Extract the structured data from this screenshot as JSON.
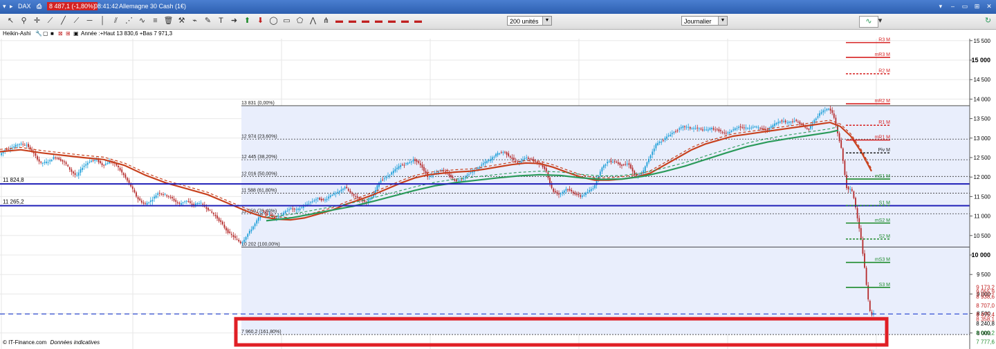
{
  "titlebar": {
    "symbol": "DAX",
    "price_badge": "8 487,1 (-1,80%)",
    "time": "08:41:42",
    "instrument": "Allemagne 30 Cash (1€)"
  },
  "toolbar": {
    "units_select": "200 unités",
    "period_select": "Journalier"
  },
  "legend": {
    "series_label": "Heikin-Ashi",
    "year_info": "Année :+Haut 13 830,6 +Bas 7 971,3"
  },
  "footer": {
    "source": "© IT-Finance.com",
    "note": "Données indicatives"
  },
  "colors": {
    "bull_candle": "#1c9ed8",
    "bear_candle": "#b52a2a",
    "ma_long": "#c8411e",
    "ma_green": "#2a9a5a",
    "support_lines": "#1f1fb8",
    "highlight_box": "#e01f25",
    "fib_band": "#e9eefc"
  },
  "chart_data": {
    "type": "candlestick",
    "y_axis": {
      "ylim": [
        7700,
        15800
      ],
      "ticks": [
        "15 500",
        "15 000",
        "14 500",
        "14 000",
        "13 500",
        "13 000",
        "12 500",
        "12 000",
        "11 500",
        "11 000",
        "10 500",
        "10 000",
        "9 500",
        "9 000",
        "8 500",
        "8 000"
      ],
      "major_ticks": [
        "15 000",
        "10 000"
      ]
    },
    "fibonacci": [
      {
        "label": "13 831 (0,00%)",
        "value": 13831
      },
      {
        "label": "12 974 (23,60%)",
        "value": 12974
      },
      {
        "label": "12 445 (38,20%)",
        "value": 12445
      },
      {
        "label": "12 016 (50,00%)",
        "value": 12016
      },
      {
        "label": "11 588 (61,80%)",
        "value": 11588
      },
      {
        "label": "11 059 (76,40%)",
        "value": 11059
      },
      {
        "label": "10 202 (100,00%)",
        "value": 10202
      },
      {
        "label": "7 960,2 (161,80%)",
        "value": 7960.2
      }
    ],
    "horizontal_lines": [
      {
        "label": "11 824,8",
        "value": 11824.8
      },
      {
        "label": "11 265,2",
        "value": 11265.2
      }
    ],
    "pivots": [
      {
        "label": "R3 M",
        "value": 15450,
        "style": "solid",
        "color": "#d62020"
      },
      {
        "label": "mR3 M",
        "value": 15070,
        "style": "solid",
        "color": "#d62020"
      },
      {
        "label": "R2 M",
        "value": 14650,
        "style": "dotted",
        "color": "#d62020"
      },
      {
        "label": "mR2 M",
        "value": 13880,
        "style": "solid",
        "color": "#d62020"
      },
      {
        "label": "R1 M",
        "value": 13330,
        "style": "dotted",
        "color": "#d62020"
      },
      {
        "label": "mR1 M",
        "value": 12950,
        "style": "solid",
        "color": "#d62020"
      },
      {
        "label": "Piv M",
        "value": 12620,
        "style": "dotted",
        "color": "#222222"
      },
      {
        "label": "mS1 M",
        "value": 11950,
        "style": "solid",
        "color": "#1c8a2a"
      },
      {
        "label": "S1 M",
        "value": 11270,
        "style": "dotted",
        "color": "#1c8a2a"
      },
      {
        "label": "mS2 M",
        "value": 10820,
        "style": "solid",
        "color": "#1c8a2a"
      },
      {
        "label": "S2 M",
        "value": 10410,
        "style": "dotted",
        "color": "#1c8a2a"
      },
      {
        "label": "mS3 M",
        "value": 9810,
        "style": "solid",
        "color": "#1c8a2a"
      },
      {
        "label": "S3 M",
        "value": 9170,
        "style": "solid",
        "color": "#1c8a2a"
      }
    ],
    "price_tags": [
      {
        "label": "9 173,2",
        "value": 9173.2,
        "color": "#c02020"
      },
      {
        "label": "9 055,9",
        "value": 9055.9,
        "color": "#c02020"
      },
      {
        "label": "8 938,6",
        "value": 8938.6,
        "color": "#c02020"
      },
      {
        "label": "8 707,0",
        "value": 8707.0,
        "color": "#c02020"
      },
      {
        "label": "8 475,4",
        "value": 8475.4,
        "color": "#c02020"
      },
      {
        "label": "8 358,1",
        "value": 8358.1,
        "color": "#c02020"
      },
      {
        "label": "8 240,8",
        "value": 8240.8,
        "color": "#000000"
      },
      {
        "label": "8 009,2",
        "value": 8009.2,
        "color": "#1c8a2a"
      },
      {
        "label": "7 777,6",
        "value": 7777.6,
        "color": "#1c8a2a"
      }
    ],
    "current_price": 8487.1,
    "price_path": [
      [
        0,
        12550
      ],
      [
        8,
        12700
      ],
      [
        18,
        12750
      ],
      [
        28,
        12850
      ],
      [
        40,
        12830
      ],
      [
        50,
        12600
      ],
      [
        60,
        12350
      ],
      [
        72,
        12400
      ],
      [
        80,
        12520
      ],
      [
        88,
        12450
      ],
      [
        96,
        12350
      ],
      [
        104,
        12150
      ],
      [
        112,
        12020
      ],
      [
        120,
        12250
      ],
      [
        130,
        12400
      ],
      [
        140,
        12450
      ],
      [
        150,
        12300
      ],
      [
        160,
        12400
      ],
      [
        170,
        12300
      ],
      [
        180,
        12050
      ],
      [
        190,
        11780
      ],
      [
        200,
        11450
      ],
      [
        210,
        11300
      ],
      [
        220,
        11400
      ],
      [
        230,
        11600
      ],
      [
        240,
        11550
      ],
      [
        250,
        11450
      ],
      [
        260,
        11300
      ],
      [
        270,
        11400
      ],
      [
        280,
        11280
      ],
      [
        290,
        11350
      ],
      [
        300,
        11200
      ],
      [
        310,
        11050
      ],
      [
        320,
        10850
      ],
      [
        330,
        10600
      ],
      [
        340,
        10450
      ],
      [
        350,
        10300
      ],
      [
        360,
        10550
      ],
      [
        370,
        10800
      ],
      [
        380,
        11100
      ],
      [
        390,
        11050
      ],
      [
        400,
        10950
      ],
      [
        410,
        11050
      ],
      [
        420,
        11200
      ],
      [
        430,
        11150
      ],
      [
        440,
        11250
      ],
      [
        450,
        11350
      ],
      [
        460,
        11450
      ],
      [
        470,
        11400
      ],
      [
        480,
        11550
      ],
      [
        490,
        11600
      ],
      [
        500,
        11750
      ],
      [
        510,
        11550
      ],
      [
        520,
        11450
      ],
      [
        530,
        11350
      ],
      [
        540,
        11500
      ],
      [
        550,
        11900
      ],
      [
        560,
        12000
      ],
      [
        570,
        12150
      ],
      [
        580,
        12300
      ],
      [
        590,
        12350
      ],
      [
        600,
        12450
      ],
      [
        610,
        12300
      ],
      [
        620,
        12000
      ],
      [
        630,
        12100
      ],
      [
        640,
        12200
      ],
      [
        650,
        12050
      ],
      [
        660,
        11900
      ],
      [
        670,
        11950
      ],
      [
        680,
        12100
      ],
      [
        690,
        12200
      ],
      [
        700,
        12350
      ],
      [
        710,
        12450
      ],
      [
        720,
        12600
      ],
      [
        730,
        12650
      ],
      [
        740,
        12500
      ],
      [
        750,
        12350
      ],
      [
        760,
        12500
      ],
      [
        770,
        12450
      ],
      [
        780,
        12350
      ],
      [
        790,
        12200
      ],
      [
        800,
        11650
      ],
      [
        810,
        11550
      ],
      [
        820,
        11700
      ],
      [
        830,
        11600
      ],
      [
        840,
        11500
      ],
      [
        850,
        11600
      ],
      [
        860,
        11750
      ],
      [
        870,
        12200
      ],
      [
        880,
        12400
      ],
      [
        890,
        12400
      ],
      [
        900,
        12300
      ],
      [
        910,
        12350
      ],
      [
        920,
        12000
      ],
      [
        930,
        12100
      ],
      [
        940,
        12500
      ],
      [
        950,
        12850
      ],
      [
        960,
        12950
      ],
      [
        970,
        13100
      ],
      [
        980,
        13200
      ],
      [
        990,
        13300
      ],
      [
        1000,
        13250
      ],
      [
        1010,
        13250
      ],
      [
        1020,
        13200
      ],
      [
        1030,
        13250
      ],
      [
        1040,
        13200
      ],
      [
        1050,
        13100
      ],
      [
        1060,
        13200
      ],
      [
        1070,
        13300
      ],
      [
        1080,
        13250
      ],
      [
        1090,
        13300
      ],
      [
        1100,
        13250
      ],
      [
        1110,
        13200
      ],
      [
        1120,
        13350
      ],
      [
        1130,
        13450
      ],
      [
        1140,
        13400
      ],
      [
        1150,
        13450
      ],
      [
        1160,
        13350
      ],
      [
        1170,
        13200
      ],
      [
        1180,
        13500
      ],
      [
        1190,
        13700
      ],
      [
        1200,
        13750
      ],
      [
        1206,
        13600
      ],
      [
        1212,
        13150
      ],
      [
        1218,
        12700
      ],
      [
        1222,
        12150
      ],
      [
        1226,
        11650
      ],
      [
        1232,
        11700
      ],
      [
        1236,
        11450
      ],
      [
        1240,
        11050
      ],
      [
        1244,
        10650
      ],
      [
        1248,
        10150
      ],
      [
        1252,
        9550
      ],
      [
        1256,
        8900
      ],
      [
        1260,
        8450
      ],
      [
        1264,
        8487
      ]
    ],
    "ma_long_path": [
      [
        0,
        12650
      ],
      [
        30,
        12700
      ],
      [
        60,
        12620
      ],
      [
        90,
        12560
      ],
      [
        120,
        12500
      ],
      [
        150,
        12450
      ],
      [
        180,
        12300
      ],
      [
        210,
        12050
      ],
      [
        240,
        11850
      ],
      [
        270,
        11700
      ],
      [
        300,
        11550
      ],
      [
        320,
        11400
      ],
      [
        340,
        11250
      ],
      [
        360,
        11100
      ],
      [
        380,
        10980
      ],
      [
        400,
        10920
      ],
      [
        420,
        10900
      ],
      [
        440,
        10950
      ],
      [
        460,
        11050
      ],
      [
        480,
        11150
      ],
      [
        500,
        11300
      ],
      [
        520,
        11420
      ],
      [
        540,
        11550
      ],
      [
        560,
        11700
      ],
      [
        580,
        11850
      ],
      [
        600,
        11980
      ],
      [
        620,
        12060
      ],
      [
        640,
        12100
      ],
      [
        660,
        12130
      ],
      [
        680,
        12150
      ],
      [
        700,
        12200
      ],
      [
        720,
        12260
      ],
      [
        740,
        12320
      ],
      [
        760,
        12360
      ],
      [
        780,
        12350
      ],
      [
        800,
        12250
      ],
      [
        820,
        12120
      ],
      [
        840,
        12000
      ],
      [
        860,
        11920
      ],
      [
        880,
        11920
      ],
      [
        900,
        11950
      ],
      [
        920,
        12000
      ],
      [
        940,
        12100
      ],
      [
        960,
        12300
      ],
      [
        980,
        12500
      ],
      [
        1000,
        12700
      ],
      [
        1020,
        12850
      ],
      [
        1040,
        12950
      ],
      [
        1060,
        13050
      ],
      [
        1080,
        13100
      ],
      [
        1100,
        13150
      ],
      [
        1120,
        13200
      ],
      [
        1140,
        13250
      ],
      [
        1160,
        13300
      ],
      [
        1180,
        13350
      ],
      [
        1200,
        13400
      ],
      [
        1215,
        13300
      ],
      [
        1230,
        13050
      ],
      [
        1245,
        12650
      ],
      [
        1260,
        12150
      ]
    ],
    "ma_green_path": [
      [
        385,
        10880
      ],
      [
        420,
        10950
      ],
      [
        450,
        11050
      ],
      [
        480,
        11150
      ],
      [
        510,
        11250
      ],
      [
        540,
        11380
      ],
      [
        570,
        11520
      ],
      [
        600,
        11660
      ],
      [
        630,
        11780
      ],
      [
        660,
        11860
      ],
      [
        690,
        11920
      ],
      [
        720,
        11980
      ],
      [
        750,
        12030
      ],
      [
        780,
        12060
      ],
      [
        810,
        12040
      ],
      [
        840,
        11980
      ],
      [
        870,
        11940
      ],
      [
        900,
        11950
      ],
      [
        930,
        12020
      ],
      [
        960,
        12140
      ],
      [
        990,
        12280
      ],
      [
        1020,
        12450
      ],
      [
        1050,
        12620
      ],
      [
        1080,
        12780
      ],
      [
        1110,
        12900
      ],
      [
        1140,
        12990
      ],
      [
        1170,
        13070
      ],
      [
        1200,
        13150
      ],
      [
        1212,
        13200
      ]
    ],
    "highlight": {
      "from_value": 8400,
      "to_value": 7800
    }
  }
}
